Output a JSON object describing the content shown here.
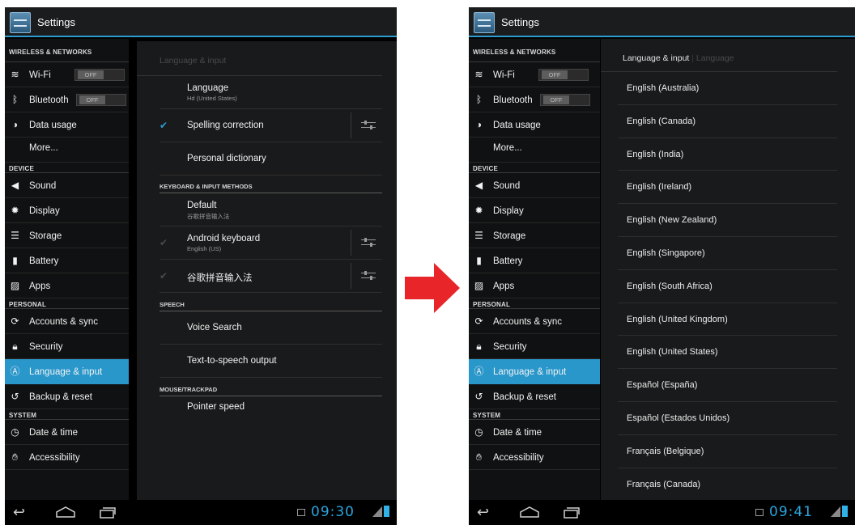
{
  "colors": {
    "accent": "#2a97cb",
    "arrow": "#e8262a",
    "clock": "#2ba5de"
  },
  "left": {
    "app_title": "Settings",
    "sidebar": {
      "headers": [
        "WIRELESS & NETWORKS",
        "DEVICE",
        "PERSONAL",
        "SYSTEM"
      ],
      "wifi_label": "Wi-Fi",
      "wifi_toggle": "OFF",
      "bluetooth_label": "Bluetooth",
      "bluetooth_toggle": "OFF",
      "data_usage": "Data usage",
      "more": "More...",
      "sound": "Sound",
      "display": "Display",
      "storage": "Storage",
      "battery": "Battery",
      "apps": "Apps",
      "accounts": "Accounts & sync",
      "security": "Security",
      "language": "Language & input",
      "backup": "Backup & reset",
      "date": "Date & time",
      "accessibility": "Accessibility"
    },
    "panel": {
      "title": "Language & input",
      "language_title": "Language",
      "language_sub": "Hd (United States)",
      "spelling": "Spelling correction",
      "dictionary": "Personal dictionary",
      "section_keyboard": "KEYBOARD & INPUT METHODS",
      "default_title": "Default",
      "default_sub": "谷歌拼音输入法",
      "android_kb": "Android keyboard",
      "android_kb_sub": "English (US)",
      "pinyin": "谷歌拼音输入法",
      "section_speech": "SPEECH",
      "voice_search": "Voice Search",
      "tts": "Text-to-speech output",
      "section_mouse": "MOUSE/TRACKPAD",
      "pointer": "Pointer speed"
    },
    "clock": "09:30"
  },
  "right": {
    "app_title": "Settings",
    "breadcrumb_current": "Language & input",
    "breadcrumb_next": "Language",
    "languages": [
      "English (Australia)",
      "English (Canada)",
      "English (India)",
      "English (Ireland)",
      "English (New Zealand)",
      "English (Singapore)",
      "English (South Africa)",
      "English (United Kingdom)",
      "English (United States)",
      "Español (España)",
      "Español (Estados Unidos)",
      "Français (Belgique)",
      "Français (Canada)"
    ],
    "clock": "09:41"
  }
}
